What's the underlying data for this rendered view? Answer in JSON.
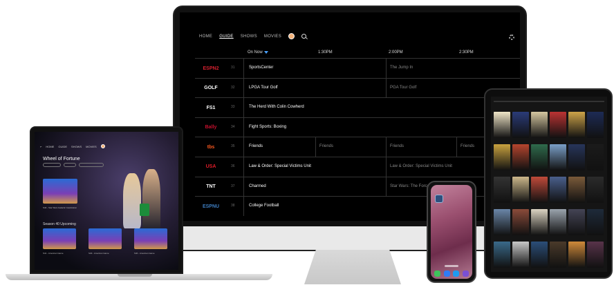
{
  "monitor": {
    "nav": {
      "home": "HOME",
      "guide": "GUIDE",
      "shows": "SHOWS",
      "movies": "MOVIES"
    },
    "times": [
      "On Now",
      "1:30PM",
      "2:00PM",
      "2:30PM"
    ],
    "rows": [
      {
        "channel": "ESPN2",
        "logo_color": "#d6202f",
        "num": "31",
        "programs": [
          {
            "title": "SportsCenter"
          },
          {
            "title": "The Jump In",
            "dim": true
          }
        ]
      },
      {
        "channel": "GOLF",
        "logo_color": "#ffffff",
        "num": "32",
        "programs": [
          {
            "title": "LPGA Tour Golf"
          },
          {
            "title": "PGA Tour Golf",
            "dim": true
          }
        ]
      },
      {
        "channel": "FS1",
        "logo_color": "#ffffff",
        "num": "33",
        "programs": [
          {
            "title": "The Herd With Colin Cowherd"
          }
        ]
      },
      {
        "channel": "Bally",
        "logo_color": "#c8102e",
        "num": "34",
        "programs": [
          {
            "title": "Fight Sports: Boxing"
          }
        ]
      },
      {
        "channel": "tbs",
        "logo_color": "#ff5a1f",
        "num": "35",
        "programs": [
          {
            "title": "Friends"
          },
          {
            "title": "Friends",
            "dim": true
          },
          {
            "title": "Friends",
            "dim": true
          },
          {
            "title": "Friends",
            "dim": true
          }
        ]
      },
      {
        "channel": "USA",
        "logo_color": "#e11d2a",
        "num": "36",
        "programs": [
          {
            "title": "Law & Order: Special Victims Unit"
          },
          {
            "title": "Law & Order: Special Victims Unit",
            "dim": true
          }
        ]
      },
      {
        "channel": "TNT",
        "logo_color": "#ffffff",
        "num": "37",
        "programs": [
          {
            "title": "Charmed"
          },
          {
            "title": "Star Wars: The Force Awakens",
            "dim": true
          }
        ]
      },
      {
        "channel": "ESPNU",
        "logo_color": "#3e7dbf",
        "num": "38",
        "programs": [
          {
            "title": "College Football"
          }
        ]
      }
    ]
  },
  "laptop": {
    "nav": [
      "HOME",
      "GUIDE",
      "SHOWS",
      "MOVIES"
    ],
    "show_title": "Wheel of Fortune",
    "section_title": "Season 40 Upcoming",
    "episodes": [
      "S40 - Star Wars Galactic Celebration",
      "S41 - American Game",
      "S40 - American Game",
      "S40 - American Game"
    ]
  },
  "tablet": {
    "poster_colors": [
      "#f0e6c8",
      "#2a3b78",
      "#d5c7a0",
      "#b33",
      "#cda349",
      "#1d2b55",
      "#c9a23f",
      "#b5452e",
      "#2f6b4c",
      "#7a9fc8",
      "#27355a",
      "#1b1b1b",
      "#333",
      "#cbb78a",
      "#c04a3a",
      "#4a5f8c",
      "#7a5a3a",
      "#2b2b2b",
      "#6a86a8",
      "#8a4b3a",
      "#dcd4c2",
      "#9aa3ad",
      "#445",
      "#1e2a3a",
      "#3a6a8a",
      "#c8c8c8",
      "#2b4e78",
      "#4a3a2a",
      "#d08a3a",
      "#58334a"
    ]
  },
  "colors": {
    "accent": "#4aa3ff",
    "guide_bg": "#000000"
  }
}
